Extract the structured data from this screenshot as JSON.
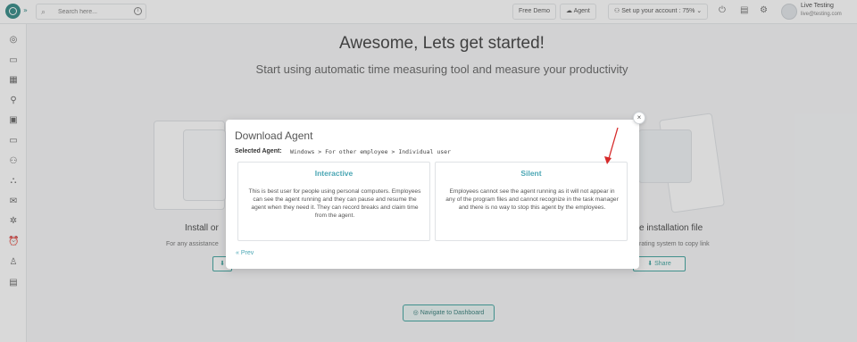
{
  "topbar": {
    "expand_glyph": "»",
    "search_placeholder": "Search here...",
    "free_demo": "Free Demo",
    "agent": "Agent",
    "setup": "Set up your account : 75%",
    "user_name": "Live Testing",
    "user_email": "live@testing.com"
  },
  "page": {
    "headline": "Awesome, Lets get started!",
    "subhead": "Start using automatic time measuring tool and measure your productivity",
    "left_title": "Install or",
    "left_text": "For any assistance",
    "right_title": "e installation file",
    "right_text": "rating system to copy link",
    "share": "Share",
    "navigate": "Navigate to Dashboard"
  },
  "modal": {
    "title": "Download Agent",
    "selected_label": "Selected Agent:",
    "selected_value": "Windows > For other employee > Individual user",
    "cards": [
      {
        "title": "Interactive",
        "desc": "This is best user for people using personal computers. Employees can see the agent running and they can pause and resume the agent when they need it. They can record breaks and claim time from the agent."
      },
      {
        "title": "Silent",
        "desc": "Employees cannot see the agent running as it will not appear in any of the program files and cannot recognize in the task manager and there is no way to stop this agent by the employees."
      }
    ],
    "prev": "Prev",
    "close": "×"
  },
  "colors": {
    "accent": "#4aa6b4",
    "brand": "#1f7f7a",
    "annotation": "#d62a2a"
  }
}
